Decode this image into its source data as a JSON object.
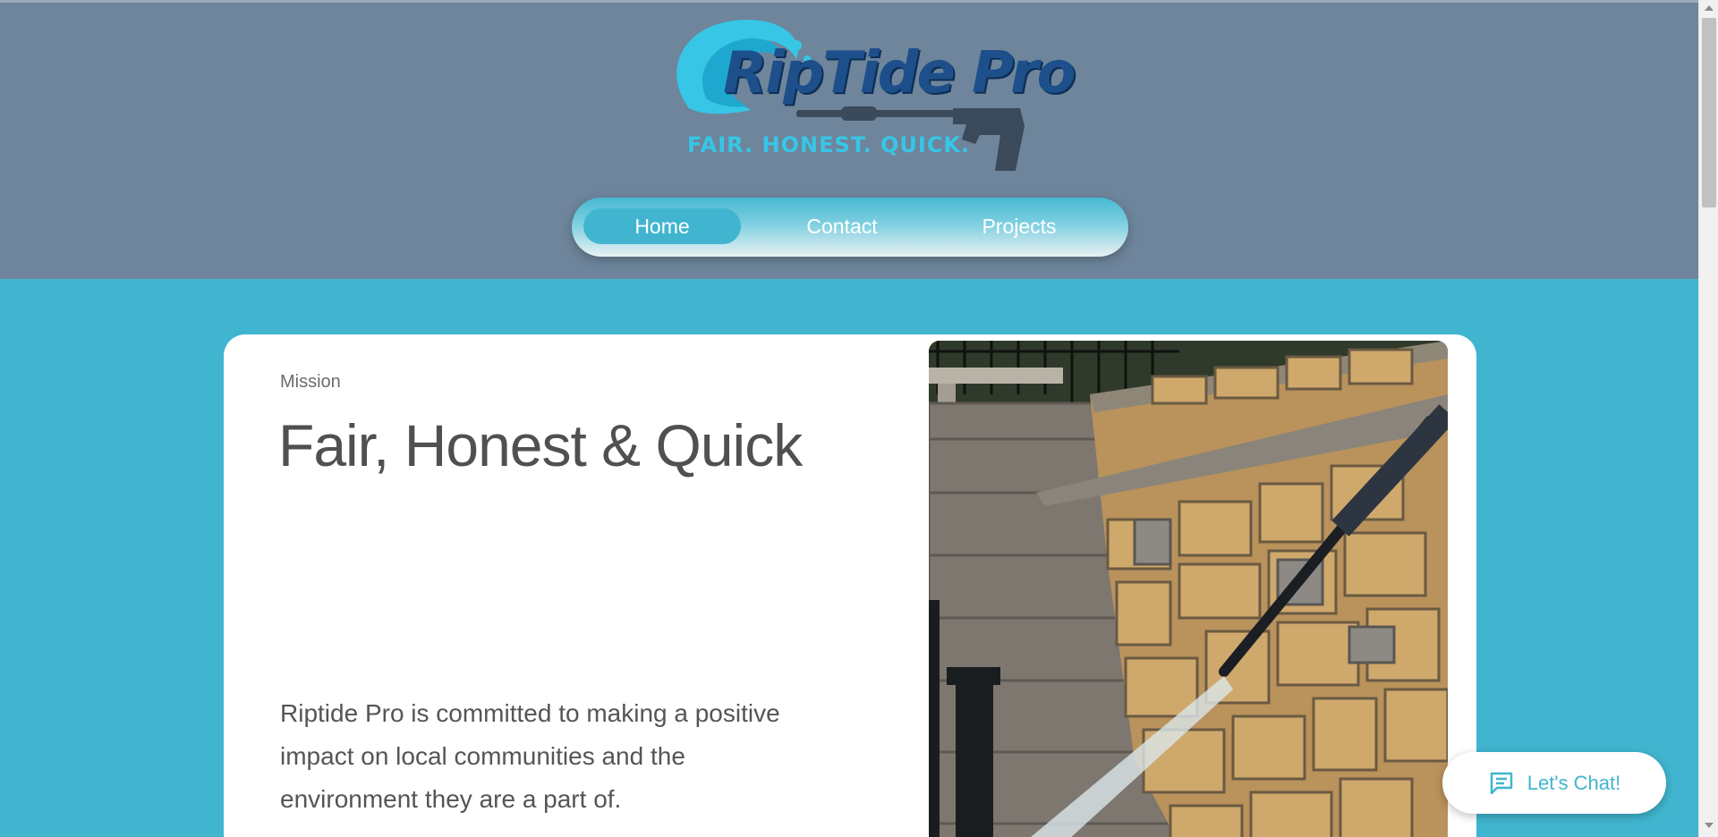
{
  "brand": {
    "logo_text": "RipTide Pro",
    "tagline": "FAIR. HONEST. QUICK.",
    "colors": {
      "header_bg": "#6e859c",
      "accent": "#41b5cf",
      "logo_navy": "#1d4f8a",
      "logo_aqua": "#37c6e6"
    }
  },
  "nav": {
    "items": [
      {
        "label": "Home",
        "active": true
      },
      {
        "label": "Contact",
        "active": false
      },
      {
        "label": "Projects",
        "active": false
      }
    ]
  },
  "mission": {
    "eyebrow": "Mission",
    "headline": "Fair, Honest & Quick",
    "body": "Riptide Pro is committed to making a positive impact on local communities and the environment they are a part of.",
    "image": "pressure-washing-stone-stairs-photo"
  },
  "chat": {
    "label": "Let's Chat!",
    "icon": "chat-bubble-icon"
  }
}
